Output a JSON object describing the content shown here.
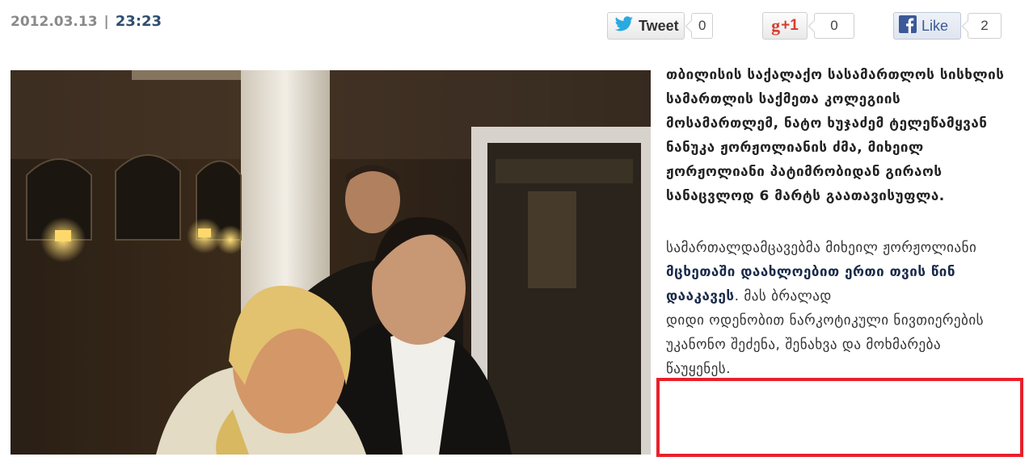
{
  "meta": {
    "date": "2012.03.13",
    "separator": "|",
    "time": "23:23"
  },
  "share": {
    "tweet": {
      "label": "Tweet",
      "count": "0",
      "icon": "twitter-bird-icon"
    },
    "gplus": {
      "label": "+1",
      "count": "0",
      "icon": "google-plus-icon"
    },
    "facebook": {
      "label": "Like",
      "count": "2",
      "icon": "facebook-f-icon"
    }
  },
  "article": {
    "paragraph1": "თბილისის საქალაქო სასამართლოს სისხლის სამართლის საქმეთა კოლეგიის მოსამართლემ, ნატო ხუჯაძემ  ტელეწამყვან ნანუკა ჟორჟოლიანის ძმა, მიხეილ ჟორჟოლიანი პატიმრობიდან გირაოს სანაცვლოდ  6 მარტს გაათავისუფლა.",
    "paragraph2_a": "სამართალდამცავებმა მიხეილ ჟორჟოლიანი ",
    "paragraph2_link": "მცხეთაში დაახლოებით ერთი თვის წინ დააკავეს",
    "paragraph2_b": ". მას ბრალად",
    "paragraph2_highlight": "დიდი ოდენობით ნარკოტიკული ნივთიერების უკანონო შეძენა, შენახვა და მოხმარება წაუყენეს."
  },
  "colors": {
    "highlight_border": "#e8202a",
    "time_color": "#2f4f6f",
    "link_color": "#1a2a4a"
  }
}
